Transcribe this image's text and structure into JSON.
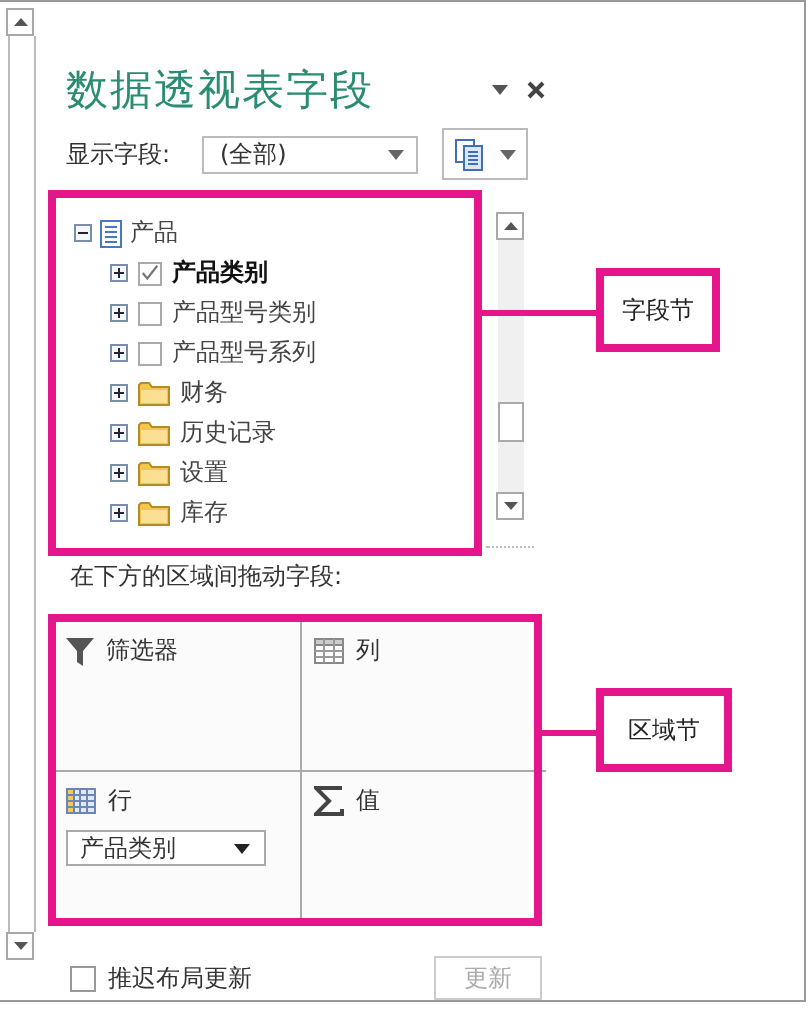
{
  "panel": {
    "title": "数据透视表字段",
    "show_fields": {
      "label": "显示字段:",
      "value": "(全部)"
    }
  },
  "field_tree": {
    "label": "产品",
    "expanded": true,
    "children": [
      {
        "kind": "field",
        "label": "产品类别",
        "checked": true,
        "expanded": false
      },
      {
        "kind": "field",
        "label": "产品型号类别",
        "checked": false,
        "expanded": false
      },
      {
        "kind": "field",
        "label": "产品型号系列",
        "checked": false,
        "expanded": false
      },
      {
        "kind": "folder",
        "label": "财务",
        "expanded": false
      },
      {
        "kind": "folder",
        "label": "历史记录",
        "expanded": false
      },
      {
        "kind": "folder",
        "label": "设置",
        "expanded": false
      },
      {
        "kind": "folder",
        "label": "库存",
        "expanded": false
      }
    ]
  },
  "areas_hint": "在下方的区域间拖动字段:",
  "areas": [
    {
      "kind": "filters",
      "label": "筛选器"
    },
    {
      "kind": "columns",
      "label": "列"
    },
    {
      "kind": "rows",
      "label": "行",
      "items": [
        "产品类别"
      ]
    },
    {
      "kind": "values",
      "label": "值"
    }
  ],
  "defer_update": {
    "label": "推迟布局更新",
    "checked": false
  },
  "update_button": {
    "label": "更新",
    "disabled": true
  },
  "callouts": [
    {
      "kind": "fields",
      "label": "字段节"
    },
    {
      "kind": "areas",
      "label": "区域节"
    }
  ]
}
